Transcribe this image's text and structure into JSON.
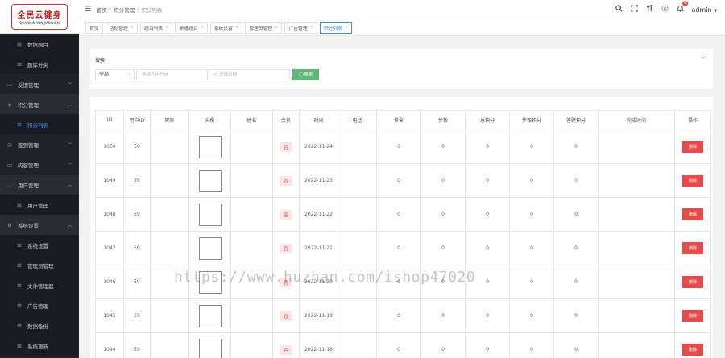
{
  "logo": {
    "text": "全民云健身",
    "subtitle": "QUANMIN YUN JIANSHEN"
  },
  "sidebar": {
    "items": [
      {
        "label": "数据题目",
        "icon": "grid-icon",
        "type": "sub"
      },
      {
        "label": "题库分类",
        "icon": "grid-icon",
        "type": "sub"
      },
      {
        "label": "反馈管理",
        "icon": "folder-icon",
        "type": "group"
      },
      {
        "label": "积分管理",
        "icon": "layers-icon",
        "type": "group-open"
      },
      {
        "label": "积分列表",
        "icon": "grid-icon",
        "type": "active"
      },
      {
        "label": "签到管理",
        "icon": "clock-icon",
        "type": "group"
      },
      {
        "label": "内容管理",
        "icon": "folder-icon",
        "type": "group"
      },
      {
        "label": "用户管理",
        "icon": "user-icon",
        "type": "group-open"
      },
      {
        "label": "用户管理",
        "icon": "grid-icon",
        "type": "sub"
      },
      {
        "label": "系统设置",
        "icon": "gear-icon",
        "type": "group-open"
      },
      {
        "label": "系统设置",
        "icon": "grid-icon",
        "type": "sub"
      },
      {
        "label": "管理员管理",
        "icon": "grid-icon",
        "type": "sub"
      },
      {
        "label": "文件管理器",
        "icon": "grid-icon",
        "type": "sub"
      },
      {
        "label": "广告管理",
        "icon": "grid-icon",
        "type": "sub"
      },
      {
        "label": "数据备份",
        "icon": "grid-icon",
        "type": "sub"
      },
      {
        "label": "系统更新",
        "icon": "grid-icon",
        "type": "sub"
      }
    ]
  },
  "header": {
    "breadcrumb": [
      "首页",
      "积分管理",
      "积分列表"
    ],
    "username": "admin",
    "notification_count": "9"
  },
  "tabs": [
    {
      "label": "首页",
      "closable": false,
      "active": false
    },
    {
      "label": "活动管理",
      "closable": true,
      "active": false
    },
    {
      "label": "题目列表",
      "closable": true,
      "active": false
    },
    {
      "label": "新增题目",
      "closable": true,
      "active": false
    },
    {
      "label": "系统设置",
      "closable": true,
      "active": false
    },
    {
      "label": "管理员管理",
      "closable": true,
      "active": false
    },
    {
      "label": "广告管理",
      "closable": true,
      "active": false
    },
    {
      "label": "积分列表",
      "closable": true,
      "active": true
    }
  ],
  "search": {
    "title": "搜索",
    "select_value": "全部",
    "user_placeholder": "请输入用户id",
    "date_placeholder": "选择日期",
    "button_label": "◯搜索"
  },
  "table": {
    "columns": [
      "ID",
      "用户ID",
      "昵称",
      "头像",
      "姓名",
      "会员",
      "时间",
      "电话",
      "排名",
      "步数",
      "总积分",
      "步数积分",
      "答题积分",
      "完成时间",
      "操作"
    ],
    "rows": [
      {
        "id": "1050",
        "user_id": "59",
        "member": "否",
        "time": "2022-11-24",
        "rank": "0",
        "steps": "0",
        "total": "0",
        "step_points": "0",
        "quiz_points": "0",
        "action": "删除"
      },
      {
        "id": "1049",
        "user_id": "59",
        "member": "否",
        "time": "2022-11-23",
        "rank": "0",
        "steps": "0",
        "total": "0",
        "step_points": "0",
        "quiz_points": "0",
        "action": "删除"
      },
      {
        "id": "1048",
        "user_id": "59",
        "member": "否",
        "time": "2022-11-22",
        "rank": "0",
        "steps": "0",
        "total": "0",
        "step_points": "0",
        "quiz_points": "0",
        "action": "删除"
      },
      {
        "id": "1047",
        "user_id": "59",
        "member": "否",
        "time": "2022-11-21",
        "rank": "0",
        "steps": "0",
        "total": "0",
        "step_points": "0",
        "quiz_points": "0",
        "action": "删除"
      },
      {
        "id": "1046",
        "user_id": "59",
        "member": "否",
        "time": "2022-11-20",
        "rank": "0",
        "steps": "0",
        "total": "0",
        "step_points": "0",
        "quiz_points": "0",
        "action": "删除"
      },
      {
        "id": "1045",
        "user_id": "59",
        "member": "否",
        "time": "2022-11-19",
        "rank": "0",
        "steps": "0",
        "total": "0",
        "step_points": "0",
        "quiz_points": "0",
        "action": "删除"
      },
      {
        "id": "1044",
        "user_id": "59",
        "member": "否",
        "time": "2022-11-18",
        "rank": "0",
        "steps": "0",
        "total": "0",
        "step_points": "0",
        "quiz_points": "0",
        "action": "删除"
      }
    ]
  },
  "watermark": "https://www.huzhan.com/ishop47020",
  "colors": {
    "sidebar_bg": "#20222a",
    "accent": "#2f8fef",
    "search_button": "#5fb878",
    "delete_button": "#e84a4a"
  }
}
